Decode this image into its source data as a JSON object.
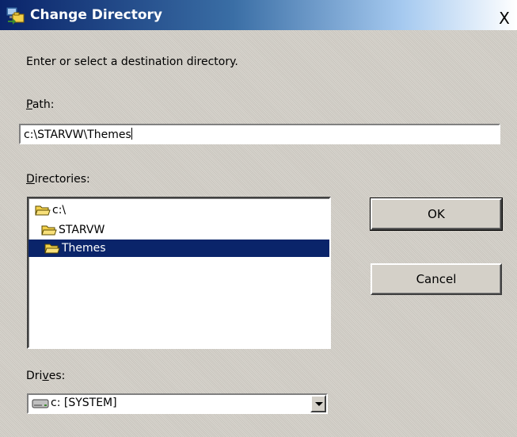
{
  "window": {
    "title": "Change Directory",
    "close_label": "X"
  },
  "instruction": "Enter or select a destination directory.",
  "path": {
    "label_accel": "P",
    "label_rest": "ath:",
    "value": "c:\\STARVW\\Themes"
  },
  "directories": {
    "label_accel": "D",
    "label_rest": "irectories:",
    "items": [
      {
        "label": "c:\\",
        "selected": false
      },
      {
        "label": "STARVW",
        "selected": false
      },
      {
        "label": "Themes",
        "selected": true
      }
    ]
  },
  "buttons": {
    "ok": "OK",
    "cancel": "Cancel"
  },
  "drives": {
    "label_pre": "Dri",
    "label_accel": "v",
    "label_post": "es:",
    "selected": "c: [SYSTEM]"
  },
  "colors": {
    "selection": "#0a246a",
    "dialog_face": "#d4d0c8",
    "folder": "#f2d04b"
  },
  "icons": {
    "title": "change-directory-icon",
    "folder": "folder-icon",
    "drive": "drive-icon",
    "dropdown": "chevron-down-icon"
  }
}
